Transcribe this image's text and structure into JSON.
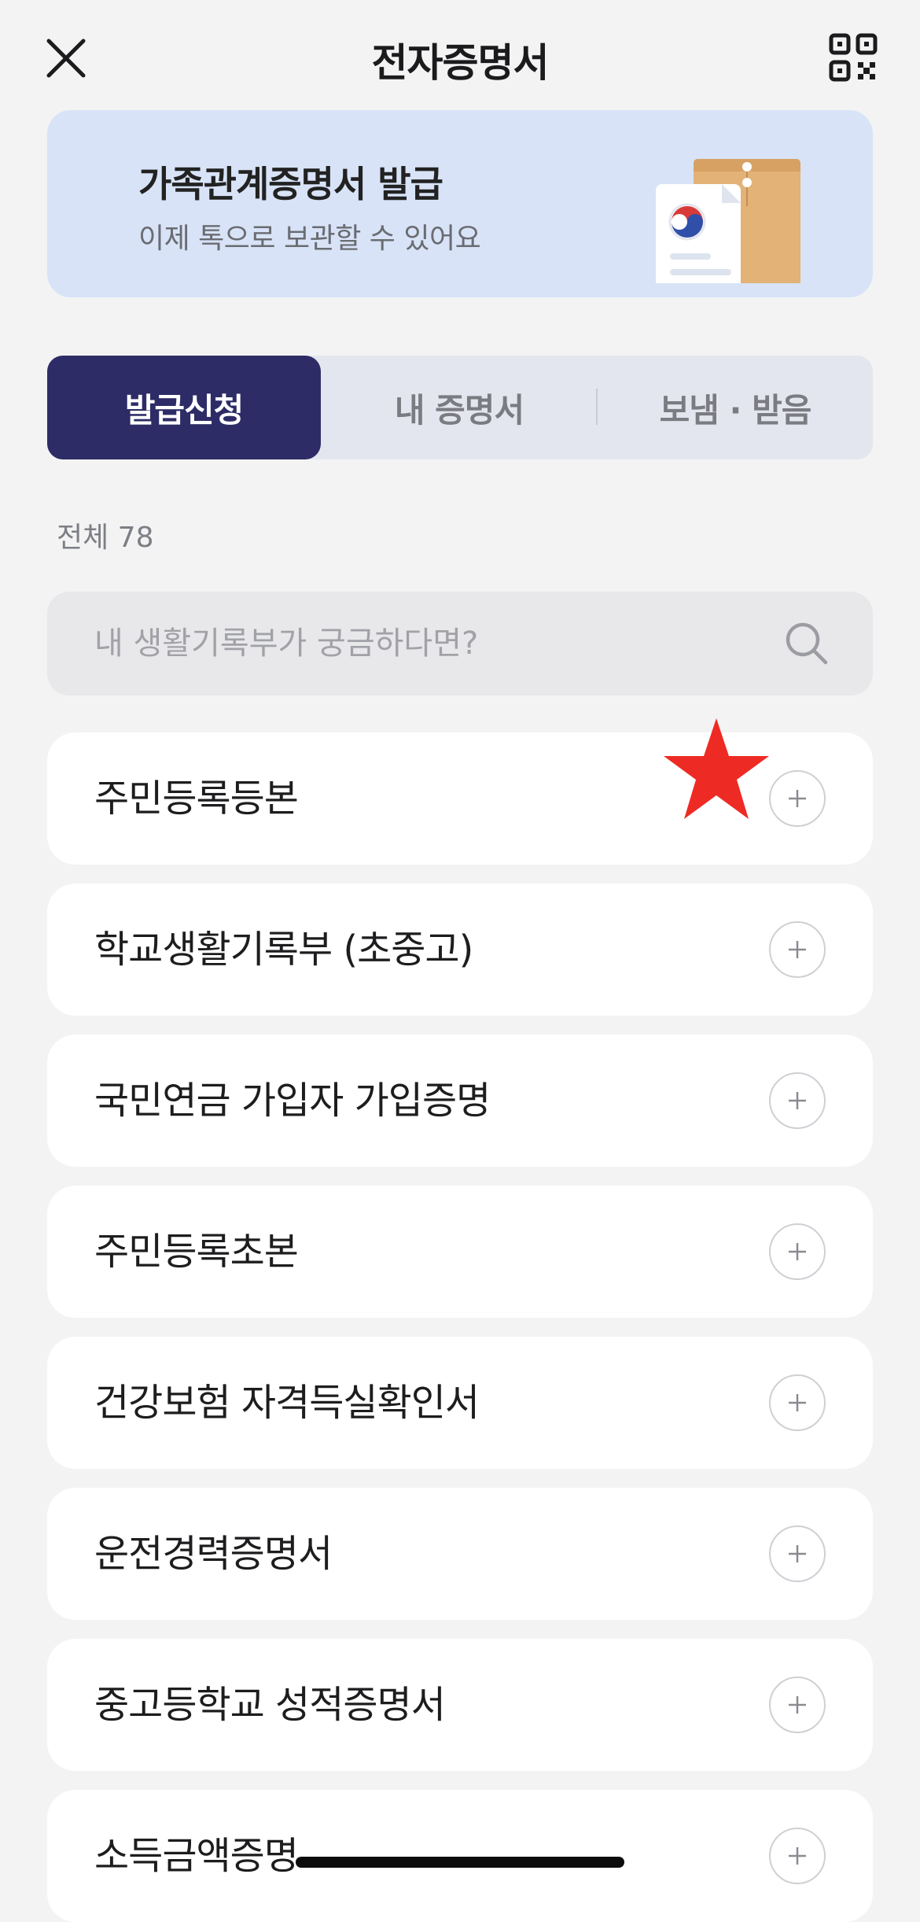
{
  "header": {
    "title": "전자증명서",
    "close_icon": "close-icon",
    "qr_icon": "qr-code-icon"
  },
  "banner": {
    "title": "가족관계증명서 발급",
    "subtitle": "이제 톡으로 보관할 수 있어요",
    "illustration": "certificate-envelope-illustration"
  },
  "tabs": [
    {
      "label": "발급신청",
      "active": true
    },
    {
      "label": "내 증명서",
      "active": false
    },
    {
      "label": "보냄 · 받음",
      "active": false
    }
  ],
  "count_text": "전체 78",
  "search": {
    "placeholder": "내 생활기록부가 궁금하다면?",
    "icon": "search-icon"
  },
  "items": [
    {
      "label": "주민등록등본"
    },
    {
      "label": "학교생활기록부 (초중고)"
    },
    {
      "label": "국민연금 가입자 가입증명"
    },
    {
      "label": "주민등록초본"
    },
    {
      "label": "건강보험 자격득실확인서"
    },
    {
      "label": "운전경력증명서"
    },
    {
      "label": "중고등학교 성적증명서"
    },
    {
      "label": "소득금액증명"
    }
  ],
  "colors": {
    "background": "#f3f3f4",
    "banner_bg": "#d8e3f7",
    "active_tab": "#2d2c66",
    "tabs_bg": "#e4e6ef",
    "search_bg": "#e8e8ea",
    "marker": "#ee2a24"
  }
}
